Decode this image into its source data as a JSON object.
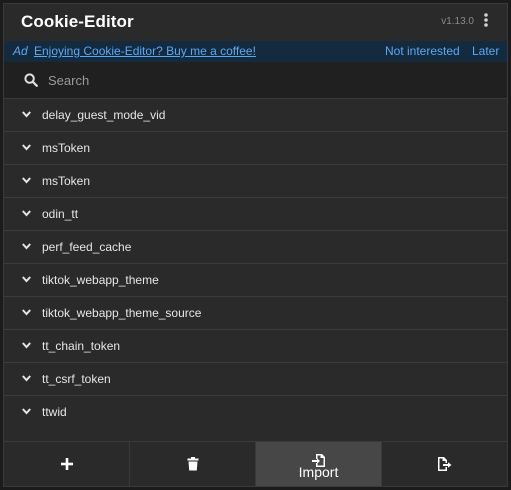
{
  "header": {
    "title": "Cookie-Editor",
    "version": "v1.13.0"
  },
  "ad": {
    "prefix": "Ad",
    "link_text": "Enjoying Cookie-Editor? Buy me a coffee!",
    "not_interested": "Not interested",
    "later": "Later"
  },
  "search": {
    "placeholder": "Search",
    "value": ""
  },
  "cookies": [
    {
      "name": "delay_guest_mode_vid"
    },
    {
      "name": "msToken"
    },
    {
      "name": "msToken"
    },
    {
      "name": "odin_tt"
    },
    {
      "name": "perf_feed_cache"
    },
    {
      "name": "tiktok_webapp_theme"
    },
    {
      "name": "tiktok_webapp_theme_source"
    },
    {
      "name": "tt_chain_token"
    },
    {
      "name": "tt_csrf_token"
    },
    {
      "name": "ttwid"
    }
  ],
  "toolbar": {
    "buttons": [
      {
        "icon": "plus-icon",
        "label": ""
      },
      {
        "icon": "trash-icon",
        "label": ""
      },
      {
        "icon": "import-icon",
        "label": "Import",
        "active": true
      },
      {
        "icon": "export-icon",
        "label": ""
      }
    ]
  },
  "colors": {
    "background": "#2a2a2a",
    "ad_bar": "#132a3f",
    "link": "#5ea8f0",
    "active_button": "#474747"
  }
}
